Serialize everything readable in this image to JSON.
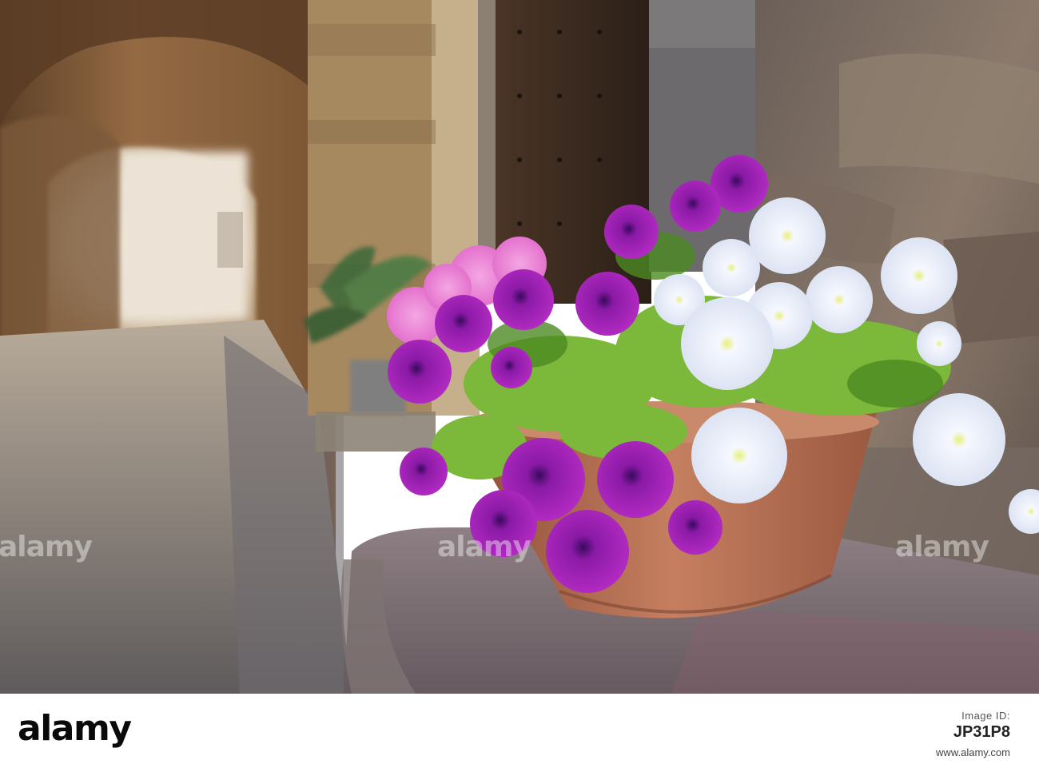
{
  "watermark": {
    "text": "alamy"
  },
  "footer": {
    "logo": "alamy",
    "image_id_label": "Image ID:",
    "image_id": "JP31P8",
    "url": "www.alamy.com"
  },
  "colors": {
    "petunia_purple": "#a01fb0",
    "petunia_white": "#f1f4fb",
    "terracotta": "#b56b4d",
    "stone": "#8a7c6a"
  }
}
